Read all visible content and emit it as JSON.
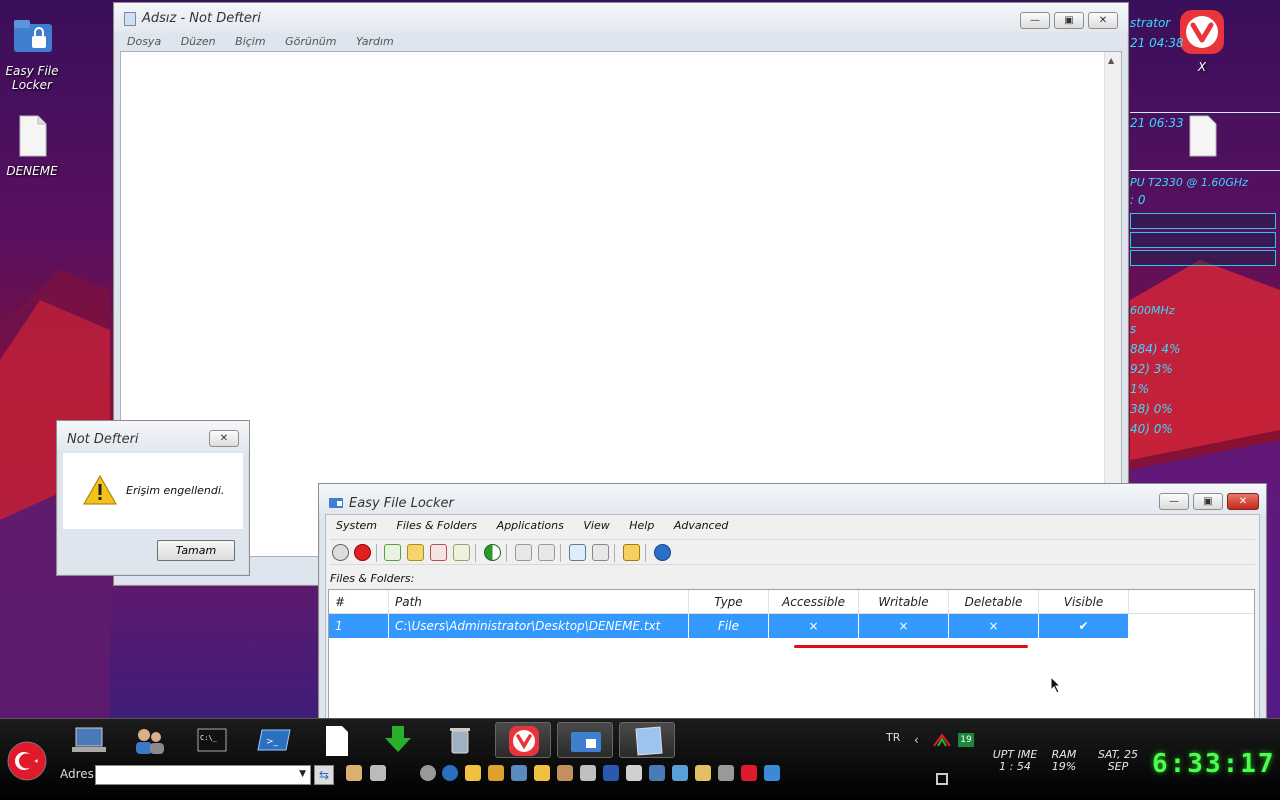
{
  "desktop": {
    "icons": [
      {
        "label": "Easy File Locker"
      },
      {
        "label": "DENEME"
      }
    ],
    "vivaldi_icon_label": "X"
  },
  "conky": {
    "lines": [
      "strator",
      "21 04:38",
      "21 06:33",
      "PU T2330 @ 1.60GHz",
      ": 0",
      "600MHz",
      "s",
      "884) 4%",
      "92) 3%",
      "1%",
      "38) 0%",
      "40) 0%"
    ]
  },
  "notepad": {
    "title": "Adsız - Not Defteri",
    "menu": [
      "Dosya",
      "Düzen",
      "Biçim",
      "Görünüm",
      "Yardım"
    ]
  },
  "dialog": {
    "title": "Not Defteri",
    "message": "Erişim engellendi.",
    "ok_label": "Tamam"
  },
  "efl": {
    "title": "Easy File Locker",
    "menu": [
      "System",
      "Files & Folders",
      "Applications",
      "View",
      "Help",
      "Advanced"
    ],
    "section_label": "Files & Folders:",
    "columns": [
      "#",
      "Path",
      "Type",
      "Accessible",
      "Writable",
      "Deletable",
      "Visible"
    ],
    "rows": [
      {
        "num": "1",
        "path": "C:\\Users\\Administrator\\Desktop\\DENEME.txt",
        "type": "File",
        "accessible": "×",
        "writable": "×",
        "deletable": "×",
        "visible": "✔"
      }
    ],
    "highlight_color": "#3399ff",
    "underline_color": "#e01010"
  },
  "taskbar": {
    "address_label": "Adres",
    "address_value": "",
    "lang": "TR",
    "tray_badge": "19",
    "uptime_label": "UPT IME",
    "uptime_value": "1 : 54",
    "ram_label": "RAM",
    "ram_value": "19%",
    "date_line1": "SAT, 25",
    "date_line2": "SEP",
    "clock": "6:33:17"
  }
}
